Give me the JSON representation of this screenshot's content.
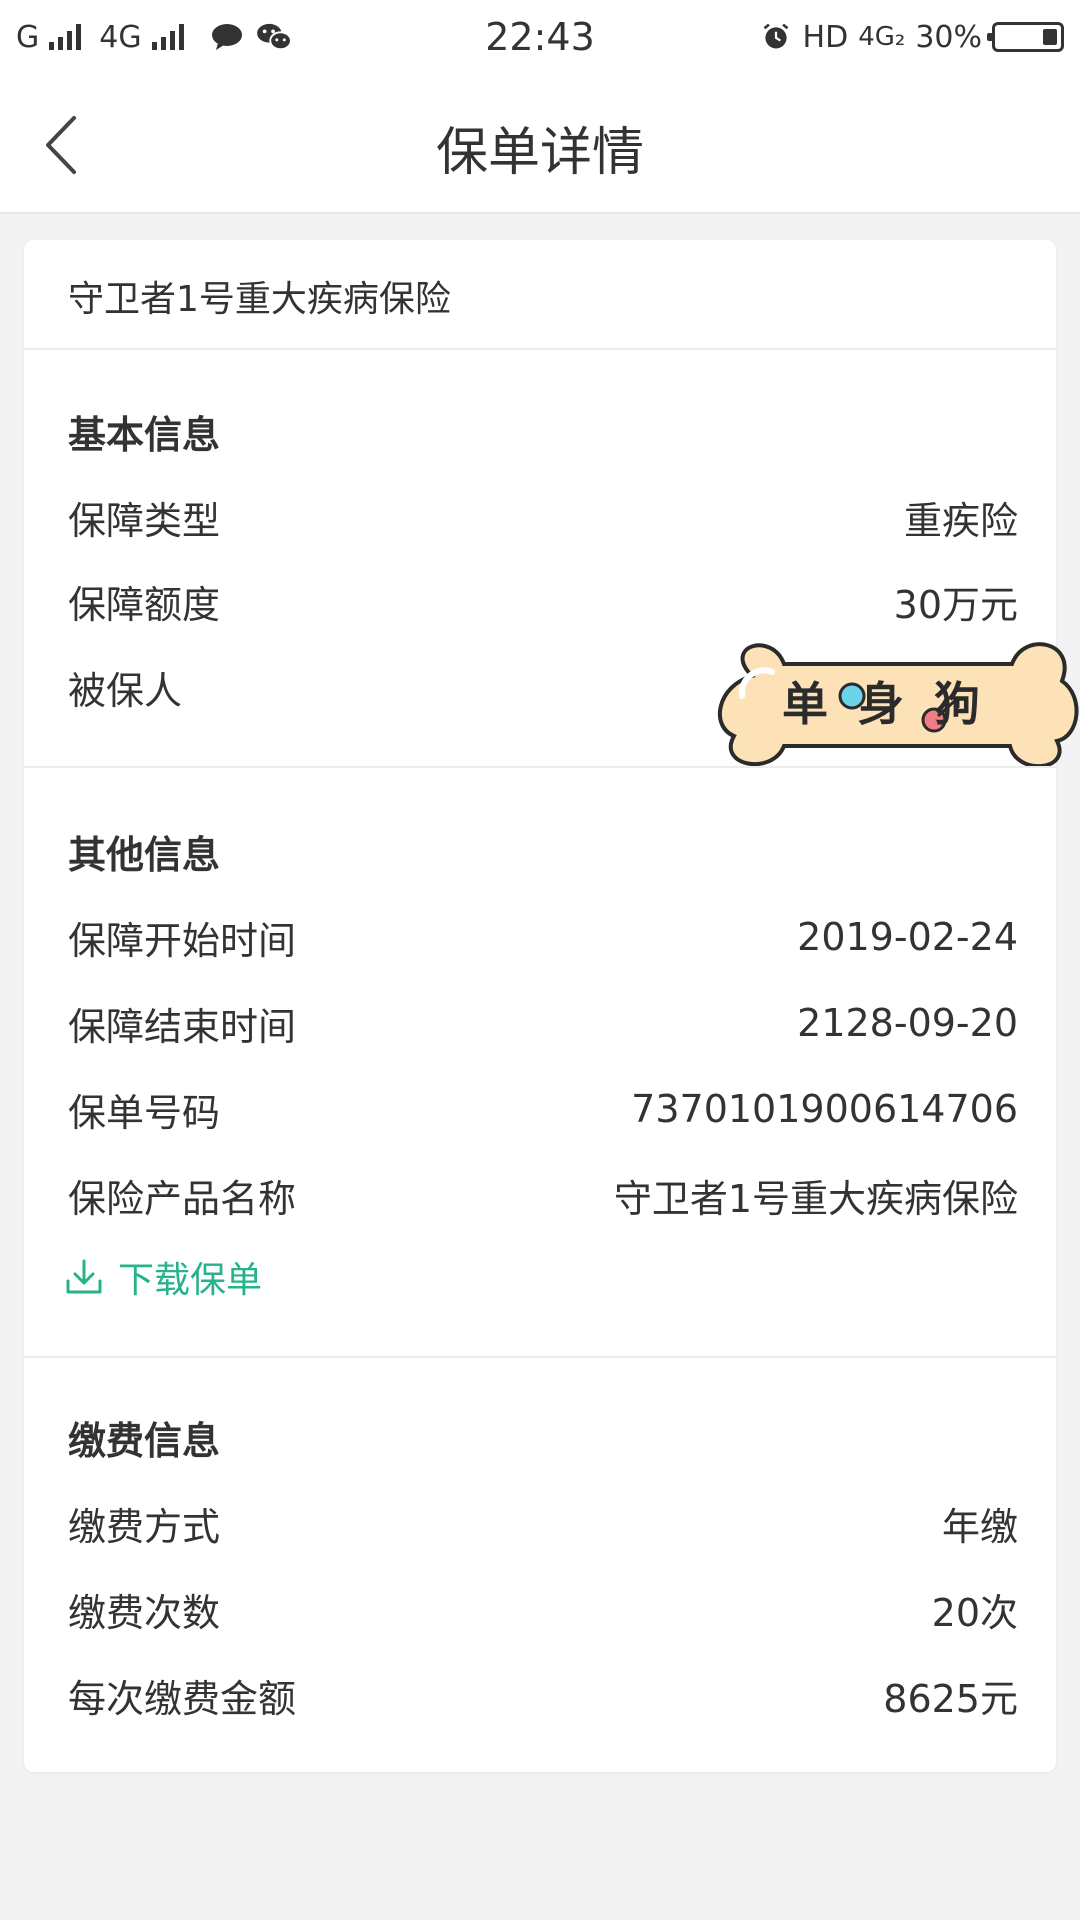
{
  "status_bar": {
    "carrier1": "G",
    "carrier2": "4G",
    "time": "22:43",
    "hd": "HD",
    "net": "4G₂",
    "battery_percent": "30%",
    "battery_level": 0.3,
    "icons": [
      "signal-icon",
      "signal-icon",
      "chat-bubble-icon",
      "wechat-icon",
      "alarm-icon",
      "battery-icon"
    ]
  },
  "header": {
    "title": "保单详情",
    "back_icon": "chevron-left-icon"
  },
  "policy": {
    "name": "守卫者1号重大疾病保险"
  },
  "basic_info": {
    "title": "基本信息",
    "rows": [
      {
        "label": "保障类型",
        "value": "重疾险"
      },
      {
        "label": "保障额度",
        "value": "30万元"
      },
      {
        "label": "被保人",
        "value": ""
      }
    ]
  },
  "other_info": {
    "title": "其他信息",
    "rows": [
      {
        "label": "保障开始时间",
        "value": "2019-02-24"
      },
      {
        "label": "保障结束时间",
        "value": "2128-09-20"
      },
      {
        "label": "保单号码",
        "value": "7370101900614706"
      },
      {
        "label": "保险产品名称",
        "value": "守卫者1号重大疾病保险"
      }
    ],
    "download_label": "下载保单",
    "download_icon": "download-icon"
  },
  "payment_info": {
    "title": "缴费信息",
    "rows": [
      {
        "label": "缴费方式",
        "value": "年缴"
      },
      {
        "label": "缴费次数",
        "value": "20次"
      },
      {
        "label": "每次缴费金额",
        "value": "8625元"
      }
    ]
  },
  "sticker": {
    "text": "单身狗"
  },
  "colors": {
    "accent": "#27b38a",
    "background": "#f3f3f4",
    "sticker_fill": "#fde2b8"
  }
}
